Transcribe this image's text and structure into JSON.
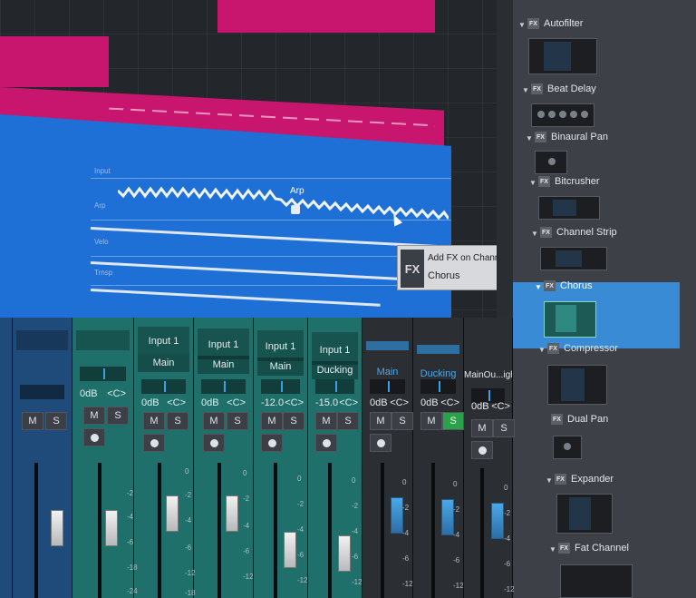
{
  "arrange": {
    "lane_labels": [
      "Input",
      "Arp",
      "Velo",
      "Trnsp"
    ],
    "arp_label": "Arp"
  },
  "tooltip": {
    "icon": "FX",
    "line1": "Add FX on Channel \"Glitch flute\":",
    "line2": "Chorus"
  },
  "browser": {
    "items": [
      {
        "name": "Autofilter",
        "expanded": true
      },
      {
        "name": "Beat Delay",
        "expanded": true
      },
      {
        "name": "Binaural Pan",
        "expanded": true
      },
      {
        "name": "Bitcrusher",
        "expanded": true
      },
      {
        "name": "Channel Strip",
        "expanded": true
      },
      {
        "name": "Chorus",
        "expanded": true,
        "selected": true
      },
      {
        "name": "Compressor",
        "expanded": true
      },
      {
        "name": "Dual Pan",
        "expanded": false
      },
      {
        "name": "Expander",
        "expanded": true
      },
      {
        "name": "Fat Channel",
        "expanded": true
      }
    ],
    "fx_icon_text": "FX",
    "selected_color": "#3a8bd6"
  },
  "mixer": {
    "channels": [
      {
        "name": "",
        "sub": "",
        "vol": "",
        "pan": "",
        "color": "blue"
      },
      {
        "name": "",
        "sub": "",
        "vol": "0dB",
        "pan": "<C>",
        "color": "blue"
      },
      {
        "name": "Input 1",
        "sub": "Main",
        "vol": "0dB",
        "pan": "<C>",
        "color": "teal"
      },
      {
        "name": "Input 1",
        "sub": "Main",
        "vol": "0dB",
        "pan": "<C>",
        "color": "teal"
      },
      {
        "name": "Input 1",
        "sub": "Main",
        "vol": "0dB",
        "pan": "<C>",
        "color": "teal"
      },
      {
        "name": "Input 1",
        "sub": "Main",
        "vol": "-12.0",
        "pan": "<C>",
        "color": "teal"
      },
      {
        "name": "Input 1",
        "sub": "Ducking",
        "vol": "-15.0",
        "pan": "<C>",
        "color": "teal"
      },
      {
        "name": "Main",
        "sub": "",
        "vol": "0dB",
        "pan": "<C>",
        "color": "gray"
      },
      {
        "name": "Ducking",
        "sub": "",
        "vol": "0dB",
        "pan": "<C>",
        "color": "gray",
        "solo": true
      },
      {
        "name": "MainOu...ight",
        "sub": "",
        "vol": "0dB",
        "pan": "<C>",
        "color": "gray"
      }
    ],
    "mute_label": "M",
    "solo_label": "S",
    "scale_marks": [
      "0",
      "-2",
      "-4",
      "-6",
      "-12",
      "-18",
      "-24"
    ]
  }
}
